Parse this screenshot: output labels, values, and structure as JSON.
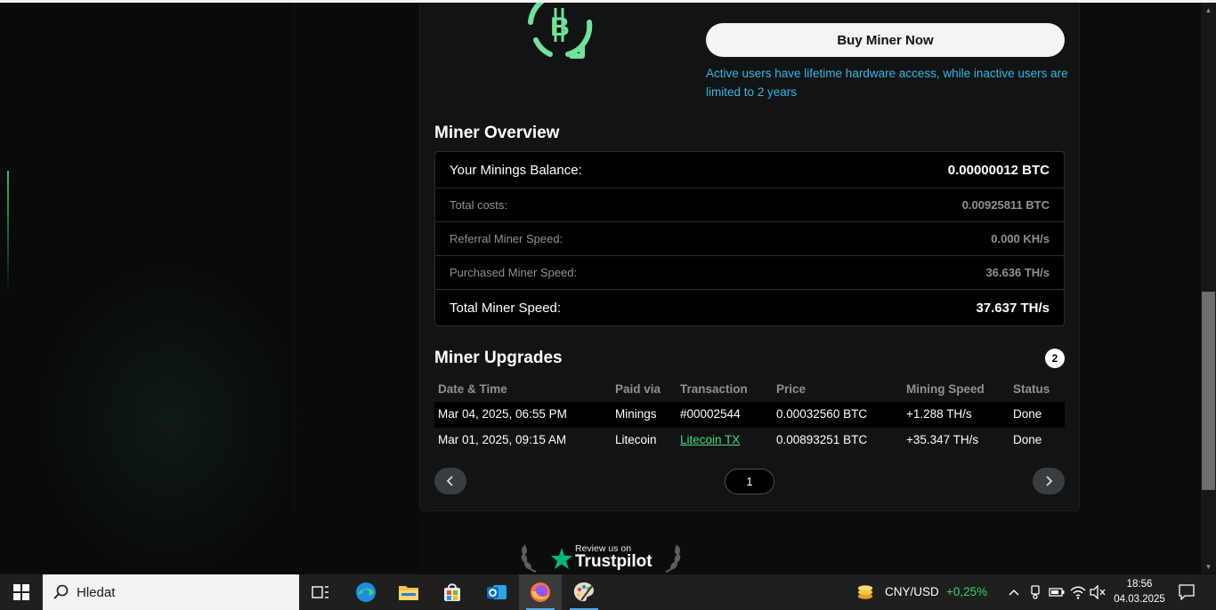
{
  "promo": {
    "buy_label": "Buy Miner Now",
    "note": "Active users have lifetime hardware access, while inactive users are limited to 2 years"
  },
  "overview": {
    "title": "Miner Overview",
    "rows": [
      {
        "label": "Your Minings Balance:",
        "value": "0.00000012 BTC"
      },
      {
        "label": "Total costs:",
        "value": "0.00925811 BTC"
      },
      {
        "label": "Referral Miner Speed:",
        "value": "0.000 KH/s"
      },
      {
        "label": "Purchased Miner Speed:",
        "value": "36.636 TH/s"
      },
      {
        "label": "Total Miner Speed:",
        "value": "37.637 TH/s"
      }
    ]
  },
  "upgrades": {
    "title": "Miner Upgrades",
    "count": "2",
    "columns": [
      "Date & Time",
      "Paid via",
      "Transaction",
      "Price",
      "Mining Speed",
      "Status"
    ],
    "rows": [
      {
        "date": "Mar 04, 2025, 06:55 PM",
        "paid_via": "Minings",
        "transaction": "#00002544",
        "price": "0.00032560 BTC",
        "speed": "+1.288 TH/s",
        "status": "Done"
      },
      {
        "date": "Mar 01, 2025, 09:15 AM",
        "paid_via": "Litecoin",
        "transaction": "Litecoin TX",
        "price": "0.00893251 BTC",
        "speed": "+35.347 TH/s",
        "status": "Done"
      }
    ],
    "page": "1",
    "prev_icon": "chevron-left",
    "next_icon": "chevron-right"
  },
  "trustpilot": {
    "small": "Review us on",
    "big": "Trustpilot"
  },
  "taskbar": {
    "search_placeholder": "Hledat",
    "currency_pair": "CNY/USD",
    "currency_change": "+0,25%",
    "time": "18:56",
    "date": "04.03.2025"
  },
  "colors": {
    "accent_green": "#3ddc84",
    "note_blue": "#38b6e8",
    "trustpilot_green": "#00b67a"
  }
}
